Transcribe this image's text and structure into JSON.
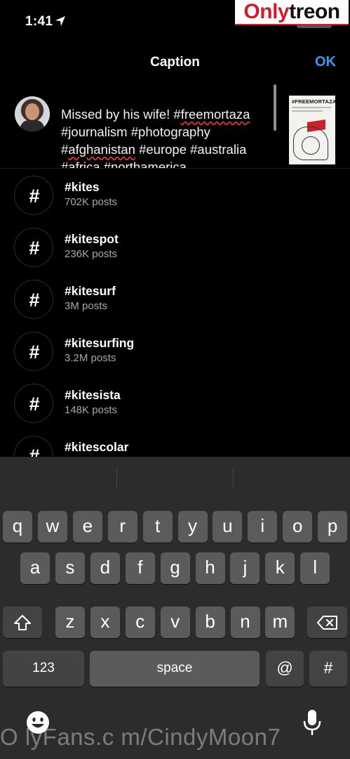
{
  "status_bar": {
    "time": "1:41"
  },
  "watermark": {
    "logo_part1": "Only",
    "logo_part2": "treon",
    "bottom_text": "O lyFans.c m/CindyMoon7"
  },
  "nav": {
    "title": "Caption",
    "ok_label": "OK"
  },
  "caption": {
    "segments": [
      {
        "text": "Missed by his wife! #",
        "squiggle": false
      },
      {
        "text": "freemortaza",
        "squiggle": true
      },
      {
        "text": " #journalism #photography #",
        "squiggle": false
      },
      {
        "text": "afghanistan",
        "squiggle": true
      },
      {
        "text": " #europe #australia #africa #northamerica",
        "squiggle": false
      }
    ],
    "thumbnail_title": "#FREEMORTAZA"
  },
  "suggestions": [
    {
      "tag": "#kites",
      "count": "702K posts"
    },
    {
      "tag": "#kitespot",
      "count": "236K posts"
    },
    {
      "tag": "#kitesurf",
      "count": "3M posts"
    },
    {
      "tag": "#kitesurfing",
      "count": "3.2M posts"
    },
    {
      "tag": "#kitesista",
      "count": "148K posts"
    },
    {
      "tag": "#kitescolar",
      "count": ""
    }
  ],
  "hash_symbol": "#",
  "keyboard": {
    "row1": [
      "q",
      "w",
      "e",
      "r",
      "t",
      "y",
      "u",
      "i",
      "o",
      "p"
    ],
    "row2": [
      "a",
      "s",
      "d",
      "f",
      "g",
      "h",
      "j",
      "k",
      "l"
    ],
    "row3": [
      "z",
      "x",
      "c",
      "v",
      "b",
      "n",
      "m"
    ],
    "numbers_label": "123",
    "space_label": "space",
    "at_label": "@",
    "hash_label": "#"
  },
  "icons": {
    "location": "location-arrow-icon",
    "shift": "shift-arrow-icon",
    "delete": "backspace-icon",
    "emoji": "emoji-face-icon",
    "mic": "microphone-icon"
  },
  "colors": {
    "accent": "#3897f0",
    "squiggle": "#e0353d",
    "keyboard_bg": "#2c2c2e",
    "key": "#5b5b5e",
    "key_fn": "#434345"
  }
}
